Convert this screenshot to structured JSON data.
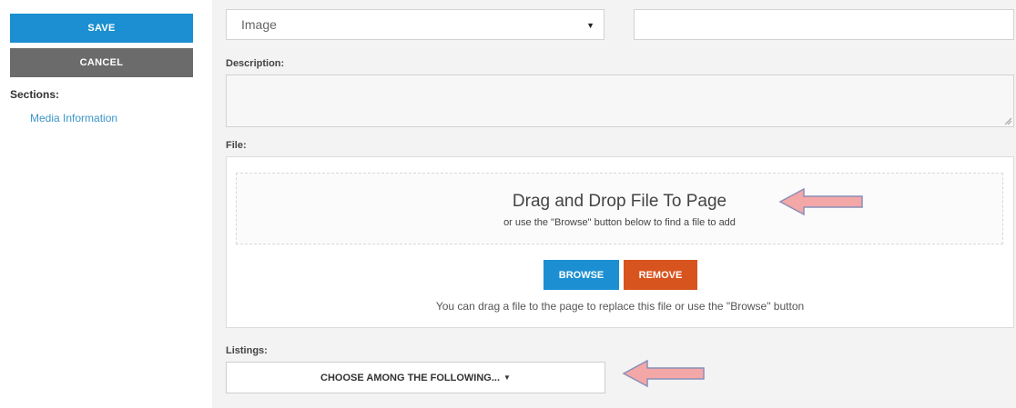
{
  "sidebar": {
    "save_label": "SAVE",
    "cancel_label": "CANCEL",
    "sections_label": "Sections:",
    "sections_items": [
      "Media Information"
    ]
  },
  "form": {
    "type_select_value": "Image",
    "description_label": "Description:",
    "file_label": "File:",
    "dropzone_title": "Drag and Drop File To Page",
    "dropzone_subtitle": "or use the \"Browse\" button below to find a file to add",
    "browse_label": "BROWSE",
    "remove_label": "REMOVE",
    "file_help": "You can drag a file to the page to replace this file or use the \"Browse\" button",
    "listings_label": "Listings:",
    "listings_button": "CHOOSE AMONG THE FOLLOWING..."
  },
  "icons": {
    "select_caret": "caret-down-icon",
    "listings_caret": "caret-down-icon",
    "annotation_arrow": "left-arrow-annotation"
  },
  "colors": {
    "primary": "#1b8fd1",
    "cancel": "#6b6b6b",
    "remove": "#d8541e",
    "link": "#3b96c9",
    "annotation_arrow": "#f4a7a7"
  }
}
